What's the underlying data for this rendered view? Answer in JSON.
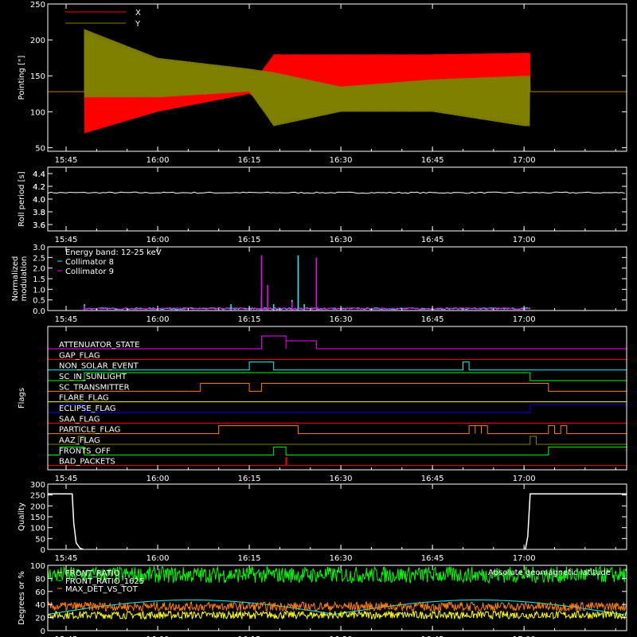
{
  "time_ticks": [
    "15:45",
    "16:00",
    "16:15",
    "16:30",
    "16:45",
    "17:00"
  ],
  "time_range_minutes": [
    15.7,
    17.28
  ],
  "chart_data": [
    {
      "type": "line",
      "id": "pointing",
      "ylabel": "Pointing [\"]",
      "ylim": [
        45,
        250
      ],
      "yticks": [
        50,
        100,
        150,
        200,
        250
      ],
      "legend_placement": "top-left",
      "series": [
        {
          "name": "X",
          "color": "#ff0000",
          "baseline": 128,
          "active_range": [
            "15:48",
            "17:01"
          ],
          "envelope": {
            "x": [
              "15:48",
              "16:00",
              "16:15",
              "16:19",
              "16:30",
              "16:45",
              "17:00"
            ],
            "upper": [
              135,
              132,
              133,
              180,
              180,
              180,
              182
            ],
            "lower": [
              70,
              100,
              125,
              100,
              130,
              140,
              140
            ]
          }
        },
        {
          "name": "Y",
          "color": "#808000",
          "baseline": 128,
          "active_range": [
            "15:48",
            "17:01"
          ],
          "envelope": {
            "x": [
              "15:48",
              "16:00",
              "16:15",
              "16:19",
              "16:30",
              "16:45",
              "17:00"
            ],
            "upper": [
              215,
              175,
              160,
              155,
              135,
              145,
              150
            ],
            "lower": [
              120,
              120,
              128,
              80,
              100,
              100,
              80
            ]
          }
        }
      ]
    },
    {
      "type": "line",
      "id": "roll",
      "ylabel": "Roll period [s]",
      "ylim": [
        3.5,
        4.5
      ],
      "yticks": [
        "3.6",
        "3.8",
        "4.0",
        "4.2",
        "4.4"
      ],
      "series": [
        {
          "name": "",
          "color": "#ffffff",
          "value": 4.1
        }
      ]
    },
    {
      "type": "line",
      "id": "modulation",
      "ylabel": [
        "Normalized",
        "modulation"
      ],
      "ylim": [
        0,
        3.0
      ],
      "yticks": [
        "0.0",
        "0.5",
        "1.0",
        "1.5",
        "2.0",
        "2.5",
        "3.0"
      ],
      "legend_placement": "top-left",
      "legend_title": "Energy band: 12-25 keV",
      "series": [
        {
          "name": "Collimator 8",
          "color": "#00ffff",
          "spikes": [
            [
              "15:48",
              0.3
            ],
            [
              "16:12",
              0.3
            ],
            [
              "16:17",
              0.7
            ],
            [
              "16:19",
              0.3
            ],
            [
              "16:22",
              0.5
            ],
            [
              "16:23",
              2.6
            ],
            [
              "16:24",
              0.3
            ]
          ]
        },
        {
          "name": "Collimator 9",
          "color": "#ff00ff",
          "spikes": [
            [
              "15:48",
              0.2
            ],
            [
              "16:17",
              2.6
            ],
            [
              "16:18",
              1.2
            ],
            [
              "16:22",
              0.4
            ],
            [
              "16:26",
              2.5
            ]
          ]
        }
      ]
    },
    {
      "type": "flags",
      "id": "flags",
      "ylabel": "Flags",
      "rows": [
        {
          "name": "ATTENUATOR_STATE",
          "color": "#ff00ff",
          "high": [
            [
              "16:17",
              "16:21",
              2
            ],
            [
              "16:21",
              "16:26",
              1
            ]
          ]
        },
        {
          "name": "GAP_FLAG",
          "color": "#ff0000",
          "high": []
        },
        {
          "name": "NON_SOLAR_EVENT",
          "color": "#00ffff",
          "high": [
            [
              "16:15",
              "16:19"
            ],
            [
              "16:50",
              "16:51"
            ]
          ]
        },
        {
          "name": "SC_IN_SUNLIGHT",
          "color": "#00ff00",
          "high": [
            [
              "15:48",
              "17:01"
            ]
          ]
        },
        {
          "name": "SC_TRANSMITTER",
          "color": "#ff8000",
          "high": [
            [
              "16:07",
              "16:15"
            ],
            [
              "16:17",
              "17:04"
            ]
          ]
        },
        {
          "name": "FLARE_FLAG",
          "color": "#ffff00",
          "high": []
        },
        {
          "name": "ECLIPSE_FLAG",
          "color": "#0000ff",
          "high": [
            [
              "15:44",
              "15:48"
            ],
            [
              "17:01",
              "17:18"
            ]
          ]
        },
        {
          "name": "SAA_FLAG",
          "color": "#ff0000",
          "high": []
        },
        {
          "name": "PARTICLE_FLAG",
          "color": "#ff8000",
          "high": [
            [
              "16:10",
              "16:23"
            ],
            [
              "16:51",
              "16:52"
            ],
            [
              "16:52",
              "16:53"
            ],
            [
              "16:53",
              "16:54"
            ],
            [
              "17:04",
              "17:05"
            ],
            [
              "17:06",
              "17:07"
            ]
          ]
        },
        {
          "name": "AAZ_FLAG",
          "color": "#808000",
          "high": [
            [
              "15:47",
              "15:48"
            ],
            [
              "17:01",
              "17:02"
            ]
          ]
        },
        {
          "name": "FRONTS_OFF",
          "color": "#00ff00",
          "high": [
            [
              "15:44",
              "15:48"
            ],
            [
              "16:19",
              "16:21"
            ],
            [
              "17:04",
              "17:18"
            ]
          ]
        },
        {
          "name": "BAD_PACKETS",
          "color": "#ff0000",
          "high": [
            [
              "16:21",
              "16:21"
            ]
          ]
        }
      ]
    },
    {
      "type": "line",
      "id": "quality",
      "ylabel": "Quality",
      "ylim": [
        0,
        300
      ],
      "yticks": [
        0,
        50,
        100,
        150,
        200,
        250,
        300
      ],
      "series": [
        {
          "name": "",
          "color": "#ffffff",
          "segments": [
            [
              "15:42",
              "15:46",
              255
            ],
            [
              "17:01",
              "17:18",
              255
            ]
          ]
        }
      ]
    },
    {
      "type": "line",
      "id": "ratios",
      "ylabel": "Degrees or %",
      "ylim": [
        0,
        100
      ],
      "yticks": [
        0,
        20,
        40,
        60,
        80,
        100
      ],
      "legend_placement": "top-left",
      "series": [
        {
          "name": "FRONT_RATIO",
          "color": "#ffff00",
          "base": 18
        },
        {
          "name": "FRONT_RATIO_1625",
          "color": "#00ff00",
          "base": 88
        },
        {
          "name": "MAX_DET_VS_TOT",
          "color": "#ff8000",
          "base": 30
        }
      ],
      "annotation": {
        "text": "Absolute geomagnetic latitude",
        "color": "#00ffff"
      }
    }
  ]
}
